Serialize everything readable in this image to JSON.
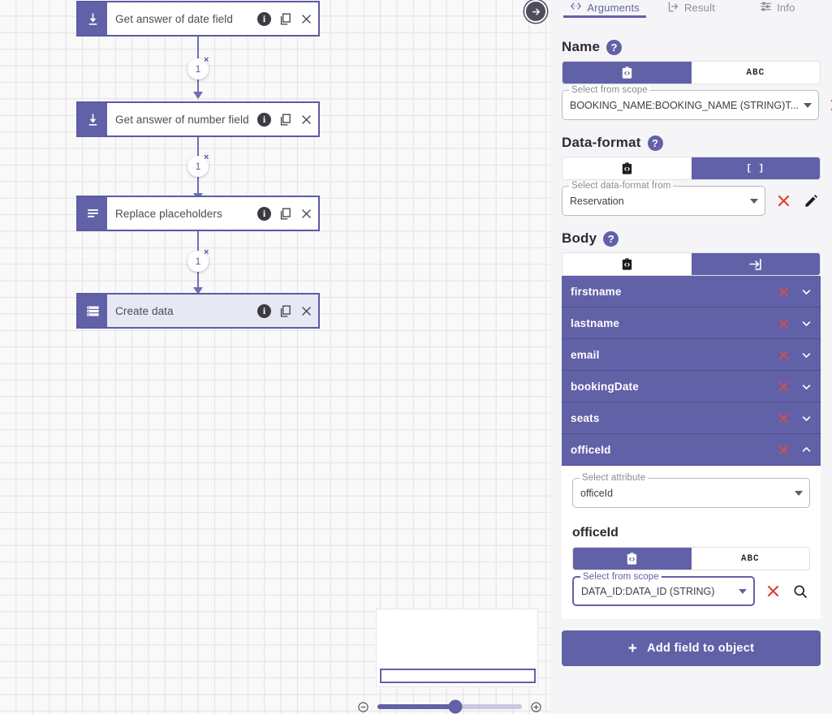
{
  "canvas": {
    "nodes": [
      {
        "title": "Get answer of date field",
        "icon": "download-icon",
        "selected": false
      },
      {
        "title": "Get answer of number field",
        "icon": "download-icon",
        "selected": false
      },
      {
        "title": "Replace placeholders",
        "icon": "text-lines-icon",
        "selected": false
      },
      {
        "title": "Create data",
        "icon": "data-list-icon",
        "selected": true
      }
    ],
    "edge_badges": [
      "1",
      "1",
      "1"
    ],
    "edge_remove_label": "×",
    "node_actions": {
      "info": "i",
      "duplicate": "copy-icon",
      "close": "×"
    },
    "pan_button": "pan-right-arrow-icon",
    "zoom": {
      "out_label": "zoom-out-icon",
      "in_label": "zoom-in-icon",
      "level_percent": 54
    },
    "accent": "#6161a8",
    "grid": true
  },
  "panel": {
    "tabs": [
      {
        "label": "Arguments",
        "icon": "arguments-code-icon",
        "active": true
      },
      {
        "label": "Result",
        "icon": "result-arrow-icon",
        "active": false
      },
      {
        "label": "Info",
        "icon": "info-sliders-icon",
        "active": false
      }
    ],
    "name_section": {
      "heading": "Name",
      "help": "?",
      "toggle": [
        {
          "icon": "clipboard-code-icon",
          "label": "",
          "active": true
        },
        {
          "icon": "abc-icon",
          "label": "ABC",
          "active": false
        }
      ],
      "select": {
        "label": "Select from scope",
        "value": "BOOKING_NAME:BOOKING_NAME (STRING)T...",
        "clear_icon": "clear-x-icon",
        "action_icon": "search-icon"
      }
    },
    "dataformat_section": {
      "heading": "Data-format",
      "help": "?",
      "toggle": [
        {
          "icon": "clipboard-code-icon",
          "label": "",
          "active": false
        },
        {
          "icon": "array-brackets-icon",
          "label": "[ ]",
          "active": true
        }
      ],
      "select": {
        "label": "Select data-format from",
        "value": "Reservation",
        "clear_icon": "clear-x-icon",
        "action_icon": "edit-pencil-icon"
      }
    },
    "body_section": {
      "heading": "Body",
      "help": "?",
      "toggle": [
        {
          "icon": "clipboard-code-icon",
          "label": "",
          "active": false
        },
        {
          "icon": "input-arrow-icon",
          "label": "",
          "active": true
        }
      ],
      "fields": [
        {
          "name": "firstname",
          "expanded": false
        },
        {
          "name": "lastname",
          "expanded": false
        },
        {
          "name": "email",
          "expanded": false
        },
        {
          "name": "bookingDate",
          "expanded": false
        },
        {
          "name": "seats",
          "expanded": false
        },
        {
          "name": "officeId",
          "expanded": true
        }
      ],
      "row_clear_icon": "clear-x-icon",
      "row_collapse_icon": "chevron-up-icon",
      "row_expand_icon": "chevron-down-icon",
      "expanded_panel": {
        "attribute_select": {
          "label": "Select attribute",
          "value": "officeId"
        },
        "attribute_title": "officeId",
        "toggle": [
          {
            "icon": "clipboard-code-icon",
            "label": "",
            "active": true
          },
          {
            "icon": "abc-icon",
            "label": "ABC",
            "active": false
          }
        ],
        "scope_select": {
          "label": "Select from scope",
          "value": "DATA_ID:DATA_ID (STRING)",
          "focused": true,
          "clear_icon": "clear-x-icon",
          "action_icon": "search-icon"
        }
      }
    },
    "add_field_button": {
      "label": "Add field to object",
      "plus": "+"
    }
  }
}
